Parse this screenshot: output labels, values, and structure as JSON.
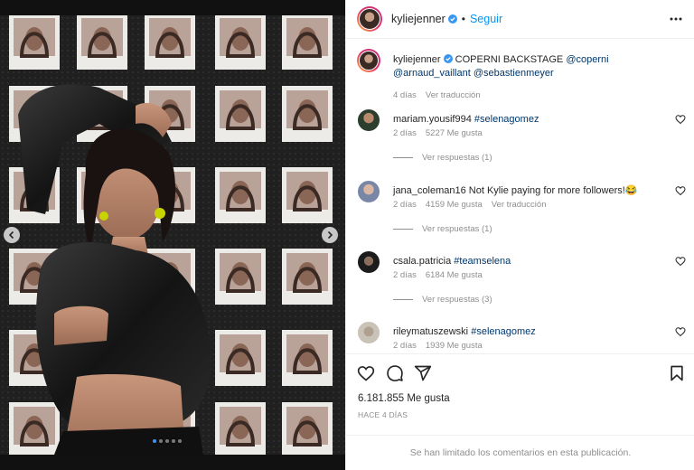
{
  "post": {
    "username": "kyliejenner",
    "follow_label": "Seguir",
    "separator": "•",
    "caption_user": "kyliejenner",
    "caption_text": "COPERNI BACKSTAGE",
    "caption_mentions": [
      "@coperni",
      "@arnaud_vaillant",
      "@sebastienmeyer"
    ],
    "caption_time": "4 días",
    "see_translation": "Ver traducción",
    "likes": "6.181.855 Me gusta",
    "posted_when": "HACE 4 DÍAS",
    "comments_limited": "Se han limitado los comentarios en esta publicación."
  },
  "carousel": {
    "total_slides": 5,
    "active_slide": 1
  },
  "comments": [
    {
      "user": "mariam.yousif994",
      "text": "",
      "tag": "#selenagomez",
      "time": "2 días",
      "likes": "5227 Me gusta",
      "extra": "",
      "replies": "Ver respuestas (1)"
    },
    {
      "user": "jana_coleman16",
      "text": "Not Kylie paying for more followers!",
      "tag": "",
      "emoji": "😂",
      "time": "2 días",
      "likes": "4159 Me gusta",
      "extra": "Ver traducción",
      "replies": "Ver respuestas (1)"
    },
    {
      "user": "csala.patricia",
      "text": "",
      "tag": "#teamselena",
      "time": "2 días",
      "likes": "6184 Me gusta",
      "extra": "",
      "replies": "Ver respuestas (3)"
    },
    {
      "user": "rileymatuszewski",
      "text": "",
      "tag": "#selenagomez",
      "time": "2 días",
      "likes": "1939 Me gusta",
      "extra": "",
      "replies": ""
    }
  ],
  "icons": {
    "verified": "verified-badge-icon",
    "more": "more-options-icon",
    "like": "heart-icon",
    "comment": "comment-bubble-icon",
    "share": "paper-plane-icon",
    "save": "bookmark-icon",
    "prev": "chevron-left-icon",
    "next": "chevron-right-icon"
  },
  "colors": {
    "accent": "#0095f6",
    "link": "#00376b",
    "muted": "#8e8e8e",
    "text": "#262626",
    "verified": "#3897f0"
  }
}
